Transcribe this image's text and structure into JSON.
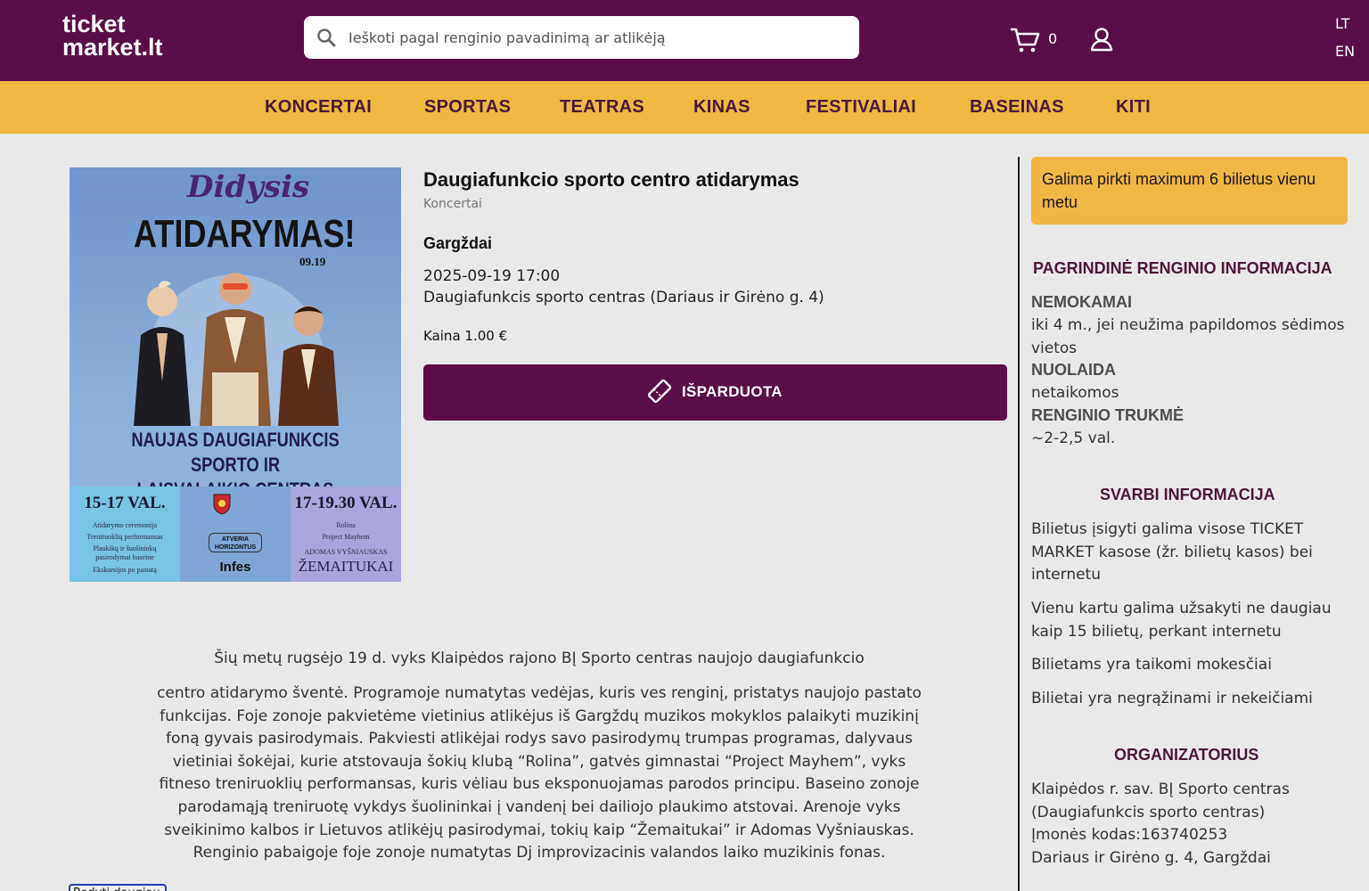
{
  "header": {
    "logo_line1": "ticket",
    "logo_line2": "market.lt",
    "search_placeholder": "Ieškoti pagal renginio pavadinimą ar atlikėją",
    "cart_count": "0",
    "lang_lt": "LT",
    "lang_en": "EN",
    "icons": {
      "search": "search-icon",
      "cart": "cart-icon",
      "user": "user-icon"
    }
  },
  "nav": {
    "items": [
      "KONCERTAI",
      "SPORTAS",
      "TEATRAS",
      "KINAS",
      "FESTIVALIAI",
      "BASEINAS",
      "KITI"
    ]
  },
  "poster": {
    "title_script": "Didysis",
    "title_main": "ATIDARYMAS!",
    "date": "09.19",
    "slogan_line1": "NAUJAS DAUGIAFUNKCIS SPORTO IR",
    "slogan_line2": "LAISVALAIKIO CENTRAS GARGŽDUOSE!",
    "left_time": "15-17 VAL.",
    "left_items": [
      "Atidarymo ceremonija",
      "Treniruoklių performansas",
      "Plaukikų ir šuolininkų",
      "pasirodymai baseine",
      "Ekskursijos po pastatą"
    ],
    "mid_badge": "ATVERIA HORIZONTUS",
    "mid_logo": "Infes",
    "right_time": "17-19.30 VAL.",
    "right_items": [
      "Rolina",
      "Project Mayhem",
      "ADOMAS VYŠNIAUSKAS"
    ],
    "right_headliner": "ŽEMAITUKAI"
  },
  "event": {
    "title": "Daugiafunkcio sporto centro atidarymas",
    "category": "Koncertai",
    "city": "Gargždai",
    "datetime": "2025-09-19 17:00",
    "venue": "Daugiafunkcis sporto centras (Dariaus ir Girėno g. 4)",
    "price": "Kaina 1.00 €",
    "sold_out_label": "IŠPARDUOTA"
  },
  "description": {
    "first": "Šių metų rugsėjo 19 d. vyks Klaipėdos rajono BĮ Sporto centras naujojo daugiafunkcio",
    "lines": [
      "centro atidarymo šventė. Programoje numatytas vedėjas, kuris ves renginį, pristatys naujojo pastato",
      "funkcijas. Foje zonoje pakvietėme vietinius atlikėjus iš Gargždų muzikos mokyklos palaikyti muzikinį",
      "foną gyvais pasirodymais. Pakviesti atlikėjai rodys savo pasirodymų trumpas programas, dalyvaus",
      "vietiniai šokėjai, kurie atstovauja šokių klubą “Rolina”, gatvės gimnastai “Project Mayhem”, vyks",
      "fitneso treniruoklių performansas, kuris vėliau bus eksponuojamas parodos principu. Baseino zonoje",
      "parodamąją treniruotę vykdys šuolininkai į vandenį bei dailiojo plaukimo atstovai. Arenoje vyks",
      "sveikinimo kalbos ir Lietuvos atlikėjų pasirodymai, tokių kaip “Žemaitukai” ir Adomas Vyšniauskas.",
      "Renginio pabaigoje foje zonoje numatytas Dj improvizacinis valandos laiko muzikinis fonas."
    ],
    "more_button": "Rodyti daugiau"
  },
  "sidebar": {
    "notice": "Galima pirkti maximum 6 bilietus vienu metu",
    "main_info_title": "PAGRINDINĖ RENGINIO INFORMACIJA",
    "free_key": "NEMOKAMAI",
    "free_val": "iki 4 m., jei neužima papildomos sėdimos vietos",
    "discount_key": "NUOLAIDA",
    "discount_val": "netaikomos",
    "duration_key": "RENGINIO TRUKMĖ",
    "duration_val": "~2-2,5 val.",
    "important_title": "SVARBI INFORMACIJA",
    "important_items": [
      "Bilietus įsigyti galima visose TICKET MARKET kasose (žr. bilietų kasos) bei internetu",
      "Vienu kartu galima užsakyti ne daugiau kaip 15 bilietų, perkant internetu",
      "Bilietams yra taikomi mokesčiai",
      "Bilietai yra negrąžinami ir nekeičiami"
    ],
    "organizer_title": "ORGANIZATORIUS",
    "organizer_lines": [
      "Klaipėdos r. sav. BĮ Sporto centras",
      "(Daugiafunkcis sporto centras)",
      "Įmonės kodas:163740253",
      "Dariaus ir Girėno g. 4, Gargždai"
    ]
  },
  "colors": {
    "header_bg": "#5a0e45",
    "nav_bg": "#f0b742",
    "page_bg": "#e9e9e9",
    "button_bg": "#5a0e45",
    "heading_text": "#4a1739"
  }
}
